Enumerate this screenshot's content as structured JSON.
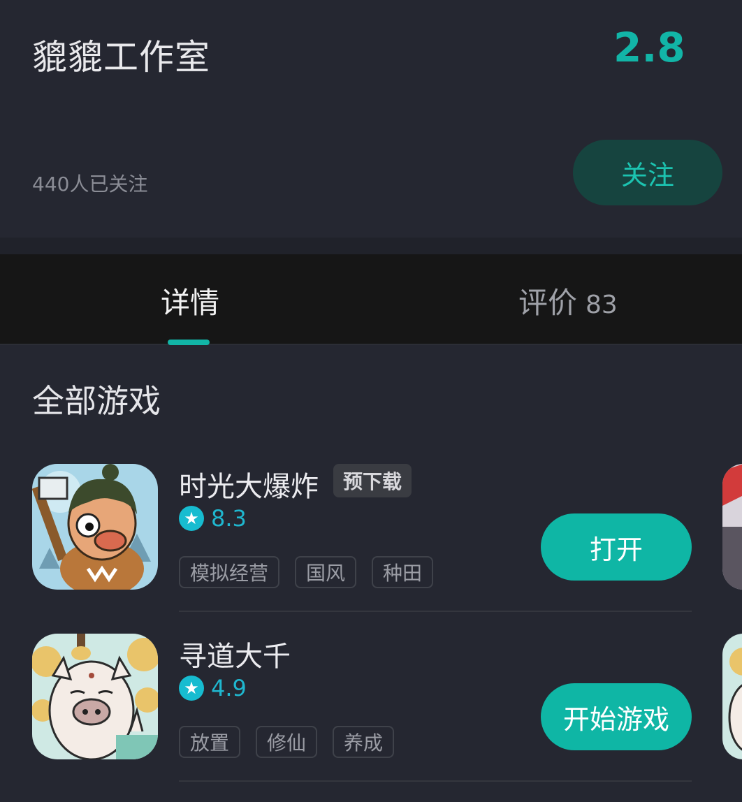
{
  "studio": {
    "name": "貔貔工作室",
    "score": "2.8",
    "followers_text": "440人已关注",
    "follow_label": "关注"
  },
  "tabs": [
    {
      "label": "详情",
      "active": true
    },
    {
      "label": "评价",
      "count": "83",
      "active": false
    }
  ],
  "section_title": "全部游戏",
  "games": [
    {
      "name": "时光大爆炸",
      "badge": "预下载",
      "rating": "8.3",
      "tags": [
        "模拟经营",
        "国风",
        "种田"
      ],
      "action_label": "打开",
      "icon": "caveman-game-icon"
    },
    {
      "name": "寻道大千",
      "rating": "4.9",
      "tags": [
        "放置",
        "修仙",
        "养成"
      ],
      "action_label": "开始游戏",
      "icon": "pig-immortal-game-icon"
    }
  ],
  "colors": {
    "accent": "#12b5a7",
    "background": "#252731",
    "tab_bar": "#161616",
    "rating": "#1fb7cf"
  }
}
